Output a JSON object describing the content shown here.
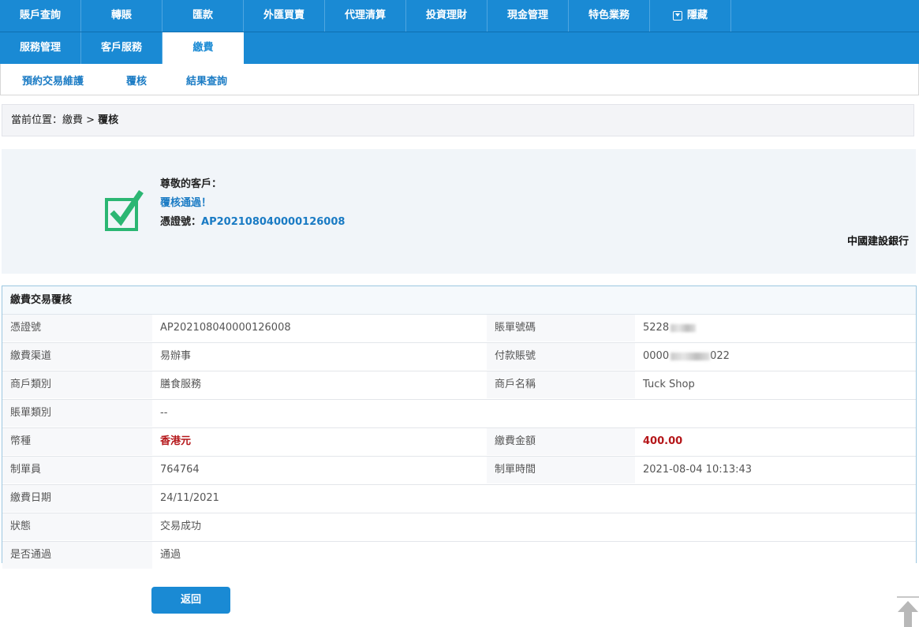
{
  "nav": {
    "row1": [
      "賬戶查詢",
      "轉賬",
      "匯款",
      "外匯買賣",
      "代理清算",
      "投資理財",
      "現金管理",
      "特色業務"
    ],
    "hide_label": "隱藏",
    "row2": [
      "服務管理",
      "客戶服務",
      "繳費"
    ]
  },
  "subnav": [
    "預約交易維護",
    "覆核",
    "結果查詢"
  ],
  "breadcrumb": {
    "prefix": "當前位置：繳費 > ",
    "current": "覆核"
  },
  "result": {
    "greeting": "尊敬的客戶：",
    "status": "覆核通過！",
    "voucher_label": "憑證號：",
    "voucher_no": "AP202108040000126008",
    "bank": "中國建設銀行",
    "icon": "checkbox-checked-icon",
    "icon_color": "#2bb673"
  },
  "detail": {
    "title": "繳費交易覆核",
    "rows": [
      {
        "l1": "憑證號",
        "v1": "AP202108040000126008",
        "l2": "賬單號碼",
        "v2": "5228"
      },
      {
        "l1": "繳費渠道",
        "v1": "易辦事",
        "l2": "付款賬號",
        "v2a": "0000",
        "v2b": "022"
      },
      {
        "l1": "商戶類別",
        "v1": "膳食服務",
        "l2": "商戶名稱",
        "v2": "Tuck Shop"
      },
      {
        "l1": "賬單類別",
        "v1": "--",
        "l2": "",
        "v2": ""
      },
      {
        "l1": "幣種",
        "v1": "香港元",
        "l2": "繳費金額",
        "v2": "400.00"
      },
      {
        "l1": "制單員",
        "v1": "764764",
        "l2": "制單時間",
        "v2": "2021-08-04 10:13:43"
      },
      {
        "l1": "繳費日期",
        "v1": "24/11/2021",
        "l2": "",
        "v2": ""
      },
      {
        "l1": "狀態",
        "v1": "交易成功",
        "l2": "",
        "v2": ""
      },
      {
        "l1": "是否通過",
        "v1": "通過",
        "l2": "",
        "v2": ""
      }
    ]
  },
  "back_label": "返回",
  "colors": {
    "primary": "#1a8ad4",
    "amount_red": "#b5171a"
  }
}
